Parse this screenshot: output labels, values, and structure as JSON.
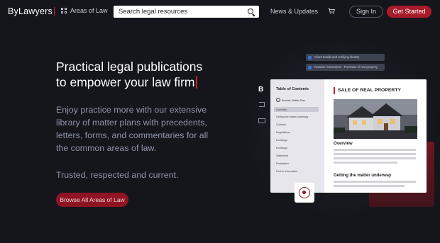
{
  "header": {
    "logo": "ByLawyers",
    "areas_label": "Areas of Law",
    "search_placeholder": "Search legal resources",
    "news_label": "News & Updates",
    "signin_label": "Sign In",
    "get_started_label": "Get Started"
  },
  "hero": {
    "title_line1": "Practical legal publications",
    "title_line2": "to empower your law firm",
    "description": "Enjoy practice more with our extensive library of matter plans with precedents, letters, forms, and commentaries for all the common areas of law.",
    "tagline": "Trusted, respected and current.",
    "browse_label": "Browse All Areas of Law"
  },
  "illustration": {
    "notifications": [
      "Client details and verifying identity",
      "Retainer instructions - Purchase of real property"
    ],
    "side_letter": "B",
    "toc_title": "Table of Contents",
    "toc_browse": "Browse Matter Plan",
    "toc_items": [
      "Overview",
      "Getting the matter underway",
      "Contract",
      "Negotiations",
      "Exchange",
      "Exchange",
      "Settlement",
      "Finalisation",
      "Further information"
    ],
    "doc_title": "SALE OF REAL PROPERTY",
    "doc_overview": "Overview",
    "doc_section2": "Getting the matter underway"
  },
  "colors": {
    "accent": "#a81b2a",
    "background": "#15161c"
  }
}
